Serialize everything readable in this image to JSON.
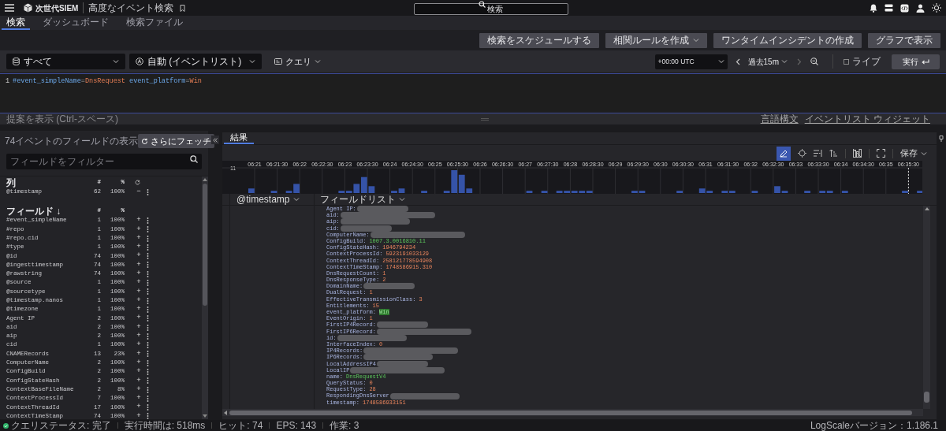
{
  "app": {
    "product": "次世代SIEM",
    "page_title": "高度なイベント検索"
  },
  "global_search": {
    "placeholder": "検索"
  },
  "tabs": [
    {
      "label": "検索",
      "selected": true
    },
    {
      "label": "ダッシュボード",
      "selected": false
    },
    {
      "label": "検索ファイル",
      "selected": false
    }
  ],
  "actions": [
    {
      "label": "検索をスケジュールする",
      "dropdown": false
    },
    {
      "label": "相関ルールを作成",
      "dropdown": true
    },
    {
      "label": "ワンタイムインシデントの作成",
      "dropdown": false
    },
    {
      "label": "グラフで表示",
      "dropdown": false
    }
  ],
  "query_bar": {
    "repository": "すべて",
    "mode": "自動 (イベントリスト)",
    "query_menu": "クエリ",
    "timezone": "+00:00 UTC",
    "time_range": "過去15m",
    "live": {
      "label": "ライブ",
      "checked": false
    },
    "run": "実行"
  },
  "editor": {
    "line_number": "1",
    "tokens": [
      {
        "text": "#event_simpleName",
        "kind": "field"
      },
      {
        "text": "=",
        "kind": "op"
      },
      {
        "text": "DnsRequest",
        "kind": "value"
      },
      {
        "text": " event_platform",
        "kind": "field"
      },
      {
        "text": "=",
        "kind": "op"
      },
      {
        "text": "Win",
        "kind": "value"
      }
    ],
    "hint": "提案を表示 (Ctrl-スペース)",
    "links": [
      "言語構文",
      "イベントリスト ウィジェット"
    ]
  },
  "fields_panel": {
    "title": "74イベントのフィールドの表示",
    "fetch_button": "さらにフェッチ",
    "filter_placeholder": "フィールドをフィルター",
    "columns_header": {
      "label": "列",
      "count": "#",
      "pct": "%"
    },
    "columns": [
      {
        "name": "@timestamp",
        "count": "62",
        "pct": "100%",
        "action": "−"
      }
    ],
    "fields_header": {
      "label": "フィールド ↓",
      "count": "#",
      "pct": "%"
    },
    "fields": [
      {
        "name": "#event_simpleName",
        "count": "1",
        "pct": "100%",
        "action": "+"
      },
      {
        "name": "#repo",
        "count": "1",
        "pct": "100%",
        "action": "+"
      },
      {
        "name": "#repo.cid",
        "count": "1",
        "pct": "100%",
        "action": "+"
      },
      {
        "name": "#type",
        "count": "1",
        "pct": "100%",
        "action": "+"
      },
      {
        "name": "@id",
        "count": "74",
        "pct": "100%",
        "action": "+"
      },
      {
        "name": "@ingesttimestamp",
        "count": "74",
        "pct": "100%",
        "action": "+"
      },
      {
        "name": "@rawstring",
        "count": "74",
        "pct": "100%",
        "action": "+"
      },
      {
        "name": "@source",
        "count": "1",
        "pct": "100%",
        "action": "+"
      },
      {
        "name": "@sourcetype",
        "count": "1",
        "pct": "100%",
        "action": "+"
      },
      {
        "name": "@timestamp.nanos",
        "count": "1",
        "pct": "100%",
        "action": "+"
      },
      {
        "name": "@timezone",
        "count": "1",
        "pct": "100%",
        "action": "+"
      },
      {
        "name": "Agent IP",
        "count": "2",
        "pct": "100%",
        "action": "+"
      },
      {
        "name": "aid",
        "count": "2",
        "pct": "100%",
        "action": "+"
      },
      {
        "name": "aip",
        "count": "2",
        "pct": "100%",
        "action": "+"
      },
      {
        "name": "cid",
        "count": "1",
        "pct": "100%",
        "action": "+"
      },
      {
        "name": "CNAMERecords",
        "count": "13",
        "pct": "23%",
        "action": "+"
      },
      {
        "name": "ComputerName",
        "count": "2",
        "pct": "100%",
        "action": "+"
      },
      {
        "name": "ConfigBuild",
        "count": "2",
        "pct": "100%",
        "action": "+"
      },
      {
        "name": "ConfigStateHash",
        "count": "2",
        "pct": "100%",
        "action": "+"
      },
      {
        "name": "ContextBaseFileName",
        "count": "2",
        "pct": "8%",
        "action": "+"
      },
      {
        "name": "ContextProcessId",
        "count": "7",
        "pct": "100%",
        "action": "+"
      },
      {
        "name": "ContextThreadId",
        "count": "17",
        "pct": "100%",
        "action": "+"
      },
      {
        "name": "ContextTimeStamp",
        "count": "74",
        "pct": "100%",
        "action": "+"
      }
    ]
  },
  "results": {
    "tab": {
      "label": "結果",
      "selected": true
    },
    "save": "保存",
    "histogram": {
      "y_label": "11",
      "time_labels": [
        "06:21",
        "06:21:30",
        "06:22",
        "06:22:30",
        "06:23",
        "06:23:30",
        "06:24",
        "06:24:30",
        "06:25",
        "06:25:30",
        "06:26",
        "06:26:30",
        "06:27",
        "06:27:30",
        "06:28",
        "06:28:30",
        "06:29",
        "06:29:30",
        "06:30",
        "06:30:30",
        "06:31",
        "06:31:30",
        "06:32",
        "06:32:30",
        "06:33",
        "06:33:30",
        "06:34",
        "06:34:30",
        "06:35",
        "06:35:30"
      ]
    },
    "table_columns": [
      "@timestamp",
      "フィールドリスト"
    ],
    "event_fields": [
      {
        "key": "Agent IP:",
        "kind": "redacted"
      },
      {
        "key": "aid:",
        "kind": "redacted"
      },
      {
        "key": "aip:",
        "kind": "redacted"
      },
      {
        "key": "cid:",
        "kind": "redacted"
      },
      {
        "key": "ComputerName:",
        "kind": "redacted"
      },
      {
        "key": "ConfigBuild:",
        "value": "1007.3.0016810.11",
        "kind": "string"
      },
      {
        "key": "ConfigStateHash:",
        "value": "1946794234",
        "kind": "number"
      },
      {
        "key": "ContextProcessId:",
        "value": "5923191033129",
        "kind": "number"
      },
      {
        "key": "ContextThreadId:",
        "value": "258121778594908",
        "kind": "number"
      },
      {
        "key": "ContextTimeStamp:",
        "value": "1748586915.310",
        "kind": "number"
      },
      {
        "key": "DnsRequestCount:",
        "value": "1",
        "kind": "number"
      },
      {
        "key": "DnsResponseType:",
        "value": "2",
        "kind": "number"
      },
      {
        "key": "DomainName:",
        "kind": "redacted"
      },
      {
        "key": "DualRequest:",
        "value": "1",
        "kind": "number"
      },
      {
        "key": "EffectiveTransmissionClass:",
        "value": "3",
        "kind": "number"
      },
      {
        "key": "Entitlements:",
        "value": "15",
        "kind": "number"
      },
      {
        "key": "event_platform:",
        "value": "Win",
        "kind": "match"
      },
      {
        "key": "EventOrigin:",
        "value": "1",
        "kind": "number"
      },
      {
        "key": "FirstIP4Record:",
        "kind": "redacted"
      },
      {
        "key": "FirstIP6Record:",
        "kind": "redacted"
      },
      {
        "key": "id:",
        "kind": "redacted"
      },
      {
        "key": "InterfaceIndex:",
        "value": "0",
        "kind": "number"
      },
      {
        "key": "IP4Records:",
        "kind": "redacted"
      },
      {
        "key": "IP6Records:",
        "kind": "redacted"
      },
      {
        "key": "LocalAddressIP4",
        "kind": "redacted"
      },
      {
        "key": "LocalIP",
        "kind": "redacted"
      },
      {
        "key": "name:",
        "value": "DnsRequestV4",
        "kind": "string"
      },
      {
        "key": "QueryStatus:",
        "value": "0",
        "kind": "number"
      },
      {
        "key": "RequestType:",
        "value": "28",
        "kind": "number"
      },
      {
        "key": "RespondingDnsServer",
        "kind": "redacted"
      },
      {
        "key": "timestamp:",
        "value": "1748586933151",
        "kind": "number"
      }
    ]
  },
  "status_bar": {
    "items": [
      "クエリステータス: 完了",
      "実行時間は: 518ms",
      "ヒット: 74",
      "EPS: 143",
      "作業: 3"
    ],
    "version": "LogScaleバージョン：1.186.1"
  }
}
